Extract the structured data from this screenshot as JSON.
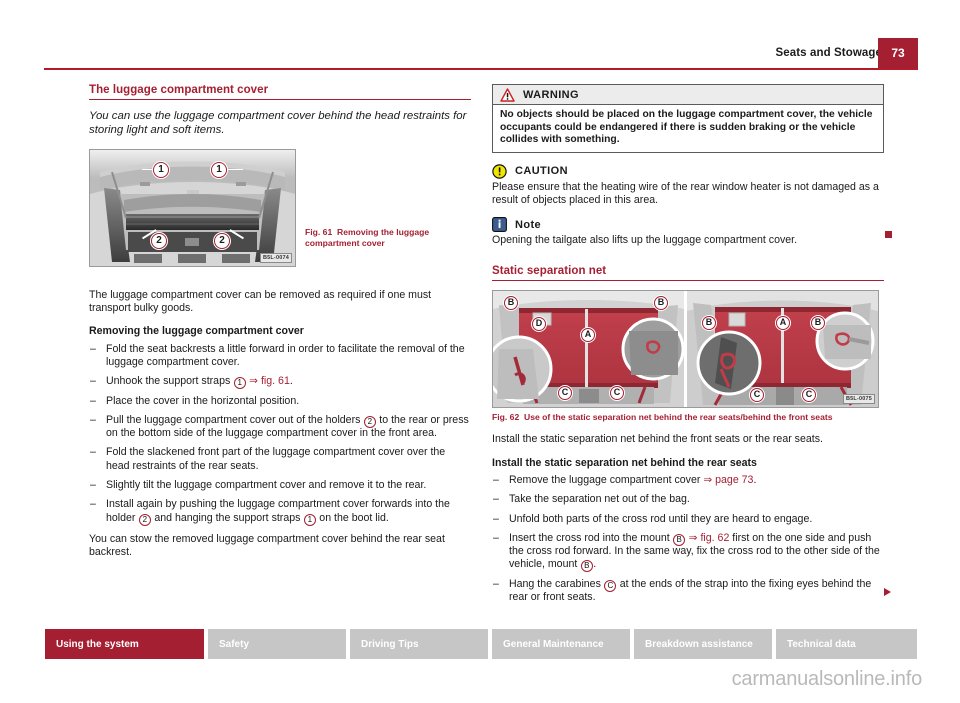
{
  "header": {
    "title": "Seats and Stowage",
    "page_number": "73"
  },
  "left_column": {
    "section_title": "The luggage compartment cover",
    "lead": "You can use the luggage compartment cover behind the head restraints for storing light and soft items.",
    "figure": {
      "caption_label": "Fig. 61",
      "caption_text": "Removing the luggage compartment cover",
      "code": "B5L-0074",
      "markers": [
        "1",
        "1",
        "2",
        "2"
      ]
    },
    "intro_paragraph": "The luggage compartment cover can be removed as required if one must transport bulky goods.",
    "procedure_heading": "Removing the luggage compartment cover",
    "steps": [
      {
        "pre": "Fold the seat backrests a little forward in order to facilitate the removal of the luggage compartment cover.",
        "callout": "",
        "xref": "",
        "post": ""
      },
      {
        "pre": "Unhook the support straps ",
        "callout": "1",
        "xref": "⇒ fig. 61",
        "post": "."
      },
      {
        "pre": "Place the cover in the horizontal position.",
        "callout": "",
        "xref": "",
        "post": ""
      },
      {
        "pre": "Pull the luggage compartment cover out of the holders ",
        "callout": "2",
        "xref": "",
        "post": " to the rear or press on the bottom side of the luggage compartment cover in the front area."
      },
      {
        "pre": "Fold the slackened front part of the luggage compartment cover over the head restraints of the rear seats.",
        "callout": "",
        "xref": "",
        "post": ""
      },
      {
        "pre": "Slightly tilt the luggage compartment cover and remove it to the rear.",
        "callout": "",
        "xref": "",
        "post": ""
      },
      {
        "pre": "Install again by pushing the luggage compartment cover forwards into the holder ",
        "callout": "2",
        "xref": "",
        "post": " and hanging the support straps ",
        "callout2": "1",
        "post2": " on the boot lid."
      }
    ],
    "closing_paragraph": "You can stow the removed luggage compartment cover behind the rear seat backrest."
  },
  "right_column": {
    "warning": {
      "icon": "warning-triangle-icon",
      "title": "WARNING",
      "body": "No objects should be placed on the luggage compartment cover, the vehicle occupants could be endangered if there is sudden braking or the vehicle collides with something."
    },
    "caution": {
      "icon": "caution-circle-icon",
      "title": "CAUTION",
      "body": "Please ensure that the heating wire of the rear window heater is not damaged as a result of objects placed in this area."
    },
    "note": {
      "icon": "info-icon",
      "title": "Note",
      "body": "Opening the tailgate also lifts up the luggage compartment cover."
    },
    "section_title": "Static separation net",
    "figure": {
      "caption_label": "Fig. 62",
      "caption_text": "Use of the static separation net behind the rear seats/behind the front seats",
      "code": "B5L-0075",
      "markers_left": [
        "B",
        "B",
        "D",
        "A",
        "C",
        "C"
      ],
      "markers_right": [
        "B",
        "A",
        "B",
        "C",
        "C"
      ]
    },
    "intro_paragraph": "Install the static separation net behind the front seats or the rear seats.",
    "procedure_heading": "Install the static separation net behind the rear seats",
    "steps": [
      {
        "pre": "Remove the luggage compartment cover ",
        "callout": "",
        "xref": "⇒ page 73",
        "post": "."
      },
      {
        "pre": "Take the separation net out of the bag.",
        "callout": "",
        "xref": "",
        "post": ""
      },
      {
        "pre": "Unfold both parts of the cross rod until they are heard to engage.",
        "callout": "",
        "xref": "",
        "post": ""
      },
      {
        "pre": "Insert the cross rod into the mount ",
        "callout": "B",
        "xref": "⇒ fig. 62",
        "post": " first on the one side and push the cross rod forward. In the same way, fix the cross rod to the other side of the vehicle, mount ",
        "callout2": "B",
        "post2": "."
      },
      {
        "pre": "Hang the carabines ",
        "callout": "C",
        "xref": "",
        "post": " at the ends of the strap into the fixing eyes behind the rear or front seats."
      }
    ]
  },
  "footer_nav": {
    "tabs": [
      {
        "label": "Using the system",
        "active": true
      },
      {
        "label": "Safety",
        "active": false
      },
      {
        "label": "Driving Tips",
        "active": false
      },
      {
        "label": "General Maintenance",
        "active": false
      },
      {
        "label": "Breakdown assistance",
        "active": false
      },
      {
        "label": "Technical data",
        "active": false
      }
    ]
  },
  "watermark": "carmanualsonline.info",
  "colors": {
    "brand_red": "#a51f32",
    "rule_red": "#b31b2c",
    "nav_inactive": "#c6c6c6"
  }
}
